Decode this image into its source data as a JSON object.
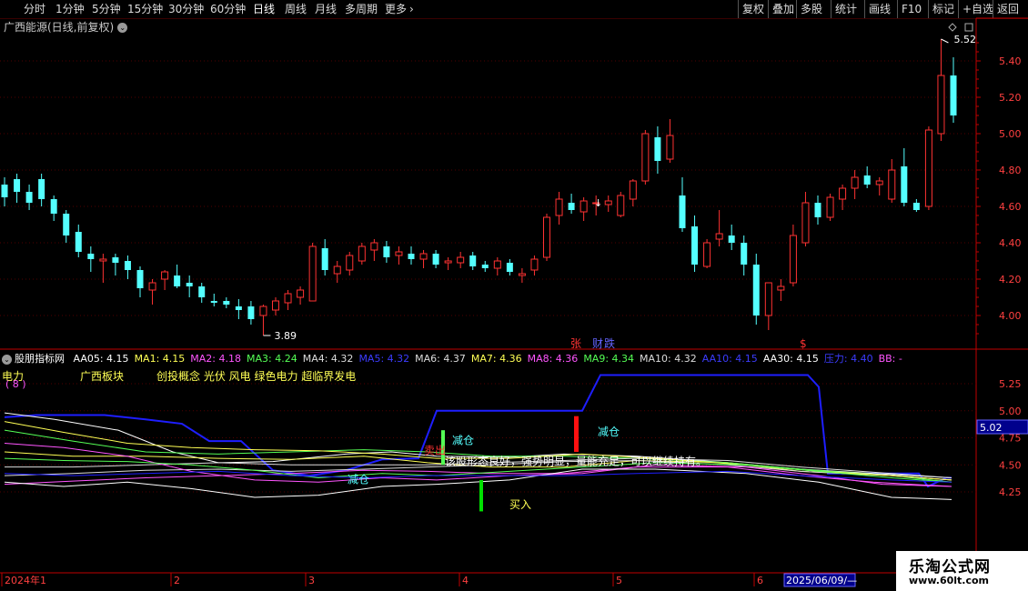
{
  "toolbar": {
    "left": [
      "分时",
      "1分钟",
      "5分钟",
      "15分钟",
      "30分钟",
      "60分钟",
      "日线",
      "周线",
      "月线",
      "多周期",
      "更多"
    ],
    "active": "日线",
    "right": [
      "复权",
      "叠加",
      "多股",
      "统计",
      "画线",
      "F10",
      "标记",
      "+自选",
      "返回"
    ]
  },
  "main_title": "广西能源(日线,前复权)",
  "price_axis": [
    "5.40",
    "5.20",
    "5.00",
    "4.80",
    "4.60",
    "4.40",
    "4.20",
    "4.00"
  ],
  "annotations": {
    "high": "5.52",
    "low": "3.89",
    "zhang": "张",
    "caiyu": "财",
    "die": "跌",
    "dollar": "$",
    "arrow_down": "↓"
  },
  "indicator": {
    "name": "股朋指标网",
    "values": [
      {
        "label": "AA05: 4.15",
        "color": "#ffffff"
      },
      {
        "label": "MA1: 4.15",
        "color": "#ffff55"
      },
      {
        "label": "MA2: 4.18",
        "color": "#ff55ff"
      },
      {
        "label": "MA3: 4.24",
        "color": "#55ff55"
      },
      {
        "label": "MA4: 4.32",
        "color": "#dcdcdc"
      },
      {
        "label": "MA5: 4.32",
        "color": "#3c3cff"
      },
      {
        "label": "MA6: 4.37",
        "color": "#dcdcdc"
      },
      {
        "label": "MA7: 4.36",
        "color": "#ffff55"
      },
      {
        "label": "MA8: 4.36",
        "color": "#ff55ff"
      },
      {
        "label": "MA9: 4.34",
        "color": "#55ff55"
      },
      {
        "label": "MA10: 4.32",
        "color": "#dcdcdc"
      },
      {
        "label": "AA10: 4.15",
        "color": "#3c3cff"
      },
      {
        "label": "AA30: 4.15",
        "color": "#ffffff"
      },
      {
        "label": "压力: 4.40",
        "color": "#3c3cff"
      },
      {
        "label": "BB: -",
        "color": "#ff55ff"
      }
    ],
    "line2_a": "电力",
    "line2_b": "广西板块",
    "line2_c": "创投概念 光伏 风电 绿色电力 超临界发电",
    "line3": "( 8 )",
    "axis": [
      "5.25",
      "5.00",
      "4.75",
      "4.50",
      "4.25"
    ],
    "highlight": "5.02",
    "notes": {
      "jiancang1": "减仓",
      "jiancang2": "减仓",
      "jiancang3": "减仓",
      "mairu": "买入",
      "sell": "卖出",
      "comment": "该股形态良好，强势明显，量能充足，可以继续持有。"
    }
  },
  "date_axis": [
    "2024年1",
    "2",
    "3",
    "4",
    "5",
    "6"
  ],
  "date_box": "2025/06/09/—",
  "watermark": {
    "line1": "乐淘公式网",
    "line2": "www.60lt.com"
  },
  "colors": {
    "up": "#ff3232",
    "down": "#54ffff",
    "axis": "#c00000",
    "bg": "#000000"
  },
  "chart_data": {
    "type": "candlestick",
    "title": "广西能源(日线,前复权)",
    "ylim": [
      3.88,
      5.55
    ],
    "candles": [
      [
        4.72,
        4.76,
        4.6,
        4.65
      ],
      [
        4.75,
        4.78,
        4.62,
        4.68
      ],
      [
        4.68,
        4.72,
        4.58,
        4.62
      ],
      [
        4.75,
        4.78,
        4.6,
        4.64
      ],
      [
        4.64,
        4.66,
        4.52,
        4.56
      ],
      [
        4.56,
        4.58,
        4.4,
        4.44
      ],
      [
        4.46,
        4.5,
        4.32,
        4.35
      ],
      [
        4.34,
        4.38,
        4.24,
        4.31
      ],
      [
        4.3,
        4.34,
        4.18,
        4.31
      ],
      [
        4.32,
        4.34,
        4.22,
        4.29
      ],
      [
        4.3,
        4.33,
        4.2,
        4.25
      ],
      [
        4.25,
        4.27,
        4.1,
        4.15
      ],
      [
        4.14,
        4.2,
        4.06,
        4.18
      ],
      [
        4.2,
        4.25,
        4.14,
        4.24
      ],
      [
        4.22,
        4.28,
        4.15,
        4.16
      ],
      [
        4.18,
        4.22,
        4.1,
        4.16
      ],
      [
        4.16,
        4.18,
        4.07,
        4.1
      ],
      [
        4.08,
        4.12,
        4.05,
        4.07
      ],
      [
        4.08,
        4.1,
        4.04,
        4.06
      ],
      [
        4.05,
        4.09,
        3.98,
        4.03
      ],
      [
        4.05,
        4.08,
        3.95,
        3.98
      ],
      [
        4.0,
        4.06,
        3.89,
        4.05
      ],
      [
        4.03,
        4.1,
        4.0,
        4.08
      ],
      [
        4.07,
        4.14,
        4.03,
        4.12
      ],
      [
        4.1,
        4.16,
        4.06,
        4.14
      ],
      [
        4.08,
        4.4,
        4.08,
        4.38
      ],
      [
        4.37,
        4.42,
        4.22,
        4.25
      ],
      [
        4.23,
        4.3,
        4.18,
        4.27
      ],
      [
        4.25,
        4.35,
        4.22,
        4.33
      ],
      [
        4.3,
        4.4,
        4.28,
        4.38
      ],
      [
        4.36,
        4.42,
        4.3,
        4.4
      ],
      [
        4.38,
        4.41,
        4.29,
        4.32
      ],
      [
        4.33,
        4.38,
        4.28,
        4.35
      ],
      [
        4.34,
        4.38,
        4.28,
        4.31
      ],
      [
        4.31,
        4.36,
        4.26,
        4.34
      ],
      [
        4.34,
        4.36,
        4.26,
        4.28
      ],
      [
        4.29,
        4.32,
        4.25,
        4.3
      ],
      [
        4.29,
        4.35,
        4.26,
        4.32
      ],
      [
        4.33,
        4.35,
        4.25,
        4.27
      ],
      [
        4.28,
        4.3,
        4.24,
        4.26
      ],
      [
        4.26,
        4.32,
        4.22,
        4.3
      ],
      [
        4.29,
        4.31,
        4.22,
        4.24
      ],
      [
        4.22,
        4.26,
        4.18,
        4.23
      ],
      [
        4.25,
        4.33,
        4.22,
        4.31
      ],
      [
        4.32,
        4.56,
        4.3,
        4.54
      ],
      [
        4.55,
        4.68,
        4.5,
        4.64
      ],
      [
        4.62,
        4.67,
        4.56,
        4.58
      ],
      [
        4.57,
        4.65,
        4.52,
        4.63
      ],
      [
        4.62,
        4.66,
        4.55,
        4.62
      ],
      [
        4.61,
        4.66,
        4.57,
        4.63
      ],
      [
        4.55,
        4.68,
        4.54,
        4.66
      ],
      [
        4.64,
        4.75,
        4.6,
        4.74
      ],
      [
        4.74,
        5.02,
        4.72,
        5.0
      ],
      [
        4.98,
        5.04,
        4.78,
        4.85
      ],
      [
        4.86,
        5.08,
        4.84,
        4.99
      ],
      [
        4.66,
        4.76,
        4.46,
        4.48
      ],
      [
        4.49,
        4.55,
        4.24,
        4.28
      ],
      [
        4.27,
        4.42,
        4.26,
        4.4
      ],
      [
        4.42,
        4.58,
        4.38,
        4.45
      ],
      [
        4.44,
        4.5,
        4.36,
        4.4
      ],
      [
        4.4,
        4.44,
        4.22,
        4.28
      ],
      [
        4.28,
        4.34,
        3.95,
        4.0
      ],
      [
        4.0,
        4.18,
        3.92,
        4.18
      ],
      [
        4.14,
        4.2,
        4.08,
        4.16
      ],
      [
        4.18,
        4.5,
        4.16,
        4.44
      ],
      [
        4.4,
        4.68,
        4.38,
        4.62
      ],
      [
        4.62,
        4.66,
        4.5,
        4.54
      ],
      [
        4.54,
        4.67,
        4.52,
        4.65
      ],
      [
        4.64,
        4.72,
        4.58,
        4.7
      ],
      [
        4.7,
        4.8,
        4.64,
        4.76
      ],
      [
        4.77,
        4.82,
        4.7,
        4.72
      ],
      [
        4.72,
        4.76,
        4.66,
        4.74
      ],
      [
        4.64,
        4.86,
        4.62,
        4.8
      ],
      [
        4.82,
        4.92,
        4.6,
        4.62
      ],
      [
        4.62,
        4.64,
        4.57,
        4.58
      ],
      [
        4.6,
        5.04,
        4.58,
        5.02
      ],
      [
        5.0,
        5.52,
        4.96,
        5.32
      ],
      [
        5.32,
        5.42,
        5.06,
        5.1
      ]
    ]
  }
}
